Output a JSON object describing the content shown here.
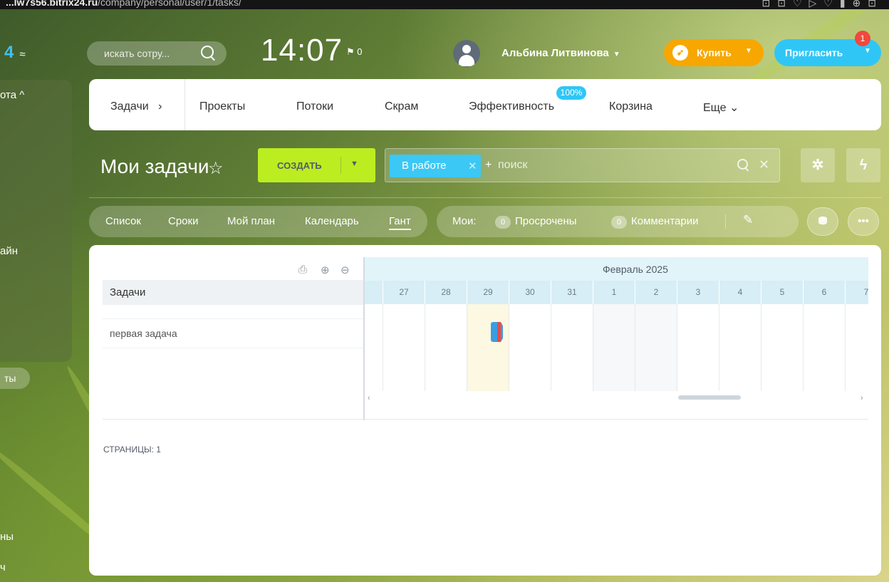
{
  "browser": {
    "url_bold": "...lw7s56.bitrix24.ru",
    "url_rest": "/company/personal/user/1/tasks/"
  },
  "header": {
    "logo_tail": "4",
    "search_placeholder": "искать сотру...",
    "clock": "14:07",
    "flag_count": "0",
    "user_name": "Альбина Литвинова",
    "buy_label": "Купить",
    "invite_label": "Пригласить",
    "invite_badge": "1"
  },
  "sidebar": {
    "items": [
      "ота ^",
      "айн",
      "ты",
      "ны",
      "ч"
    ]
  },
  "topnav": {
    "items": [
      "Задачи",
      "Проекты",
      "Потоки",
      "Скрам",
      "Эффективность",
      "Корзина",
      "Еще"
    ],
    "efficiency_badge": "100%",
    "tasks_arrow": "›",
    "more_arrow": "⌄"
  },
  "toolbar": {
    "title": "Мои задачи",
    "create_label": "СОЗДАТЬ",
    "filter_chip": "В работе",
    "search_placeholder": "поиск"
  },
  "views": {
    "items": [
      "Список",
      "Сроки",
      "Мой план",
      "Календарь",
      "Гант"
    ],
    "active": "Гант"
  },
  "counters": {
    "label": "Мои:",
    "items": [
      {
        "count": "0",
        "label": "Просрочены"
      },
      {
        "count": "0",
        "label": "Комментарии"
      }
    ]
  },
  "gantt": {
    "tasks_header": "Задачи",
    "month_label": "Февраль 2025",
    "days": [
      "27",
      "28",
      "29",
      "30",
      "31",
      "1",
      "2",
      "3",
      "4",
      "5",
      "6",
      "7"
    ],
    "tasks": [
      {
        "name": "первая задача"
      }
    ],
    "pages_label": "СТРАНИЦЫ: 1"
  },
  "colors": {
    "accent_blue": "#2fc6f6",
    "create_green": "#bbed21",
    "buy_orange": "#f7a700",
    "badge_red": "#f0483e"
  }
}
